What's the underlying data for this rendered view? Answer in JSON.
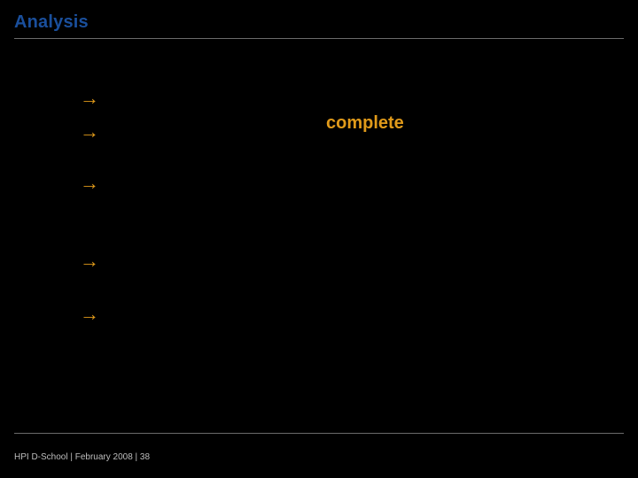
{
  "title": "Analysis",
  "highlight": "complete",
  "bullets": {
    "arrow": "→",
    "items": [
      {
        "text": ""
      },
      {
        "text": ""
      },
      {
        "text": ""
      },
      {
        "text": ""
      },
      {
        "text": ""
      }
    ]
  },
  "footer": "HPI D-School  |  February 2008  | 38"
}
